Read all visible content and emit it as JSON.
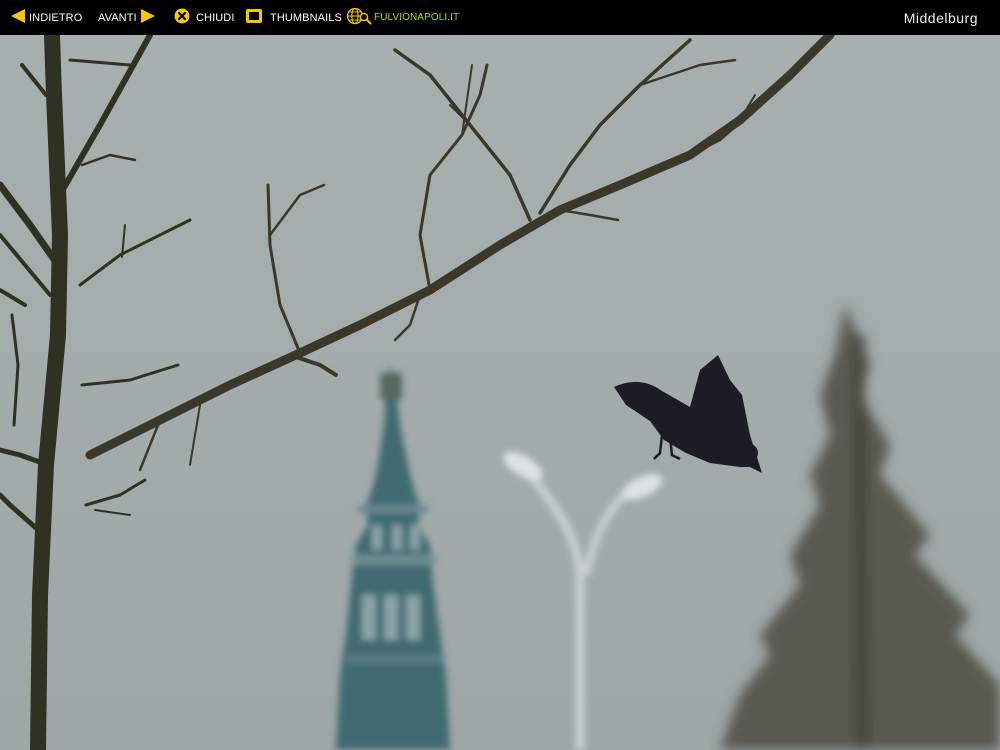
{
  "toolbar": {
    "back_label": "INDIETRO",
    "next_label": "AVANTI",
    "close_label": "CHIUDI",
    "thumbnails_label": "THUMBNAILS",
    "site_label": "FULVIONAPOLI.IT"
  },
  "gallery": {
    "title": "Middelburg"
  },
  "icons": {
    "back": "arrow-left-icon",
    "next": "arrow-right-icon",
    "close": "close-circle-icon",
    "thumbnails": "thumbnails-square-icon",
    "site": "globe-search-icon"
  },
  "colors": {
    "toolbar_bg": "#000000",
    "icon_yellow": "#f5c800",
    "site_link": "#a8e000",
    "sky": "#a6aeae"
  }
}
